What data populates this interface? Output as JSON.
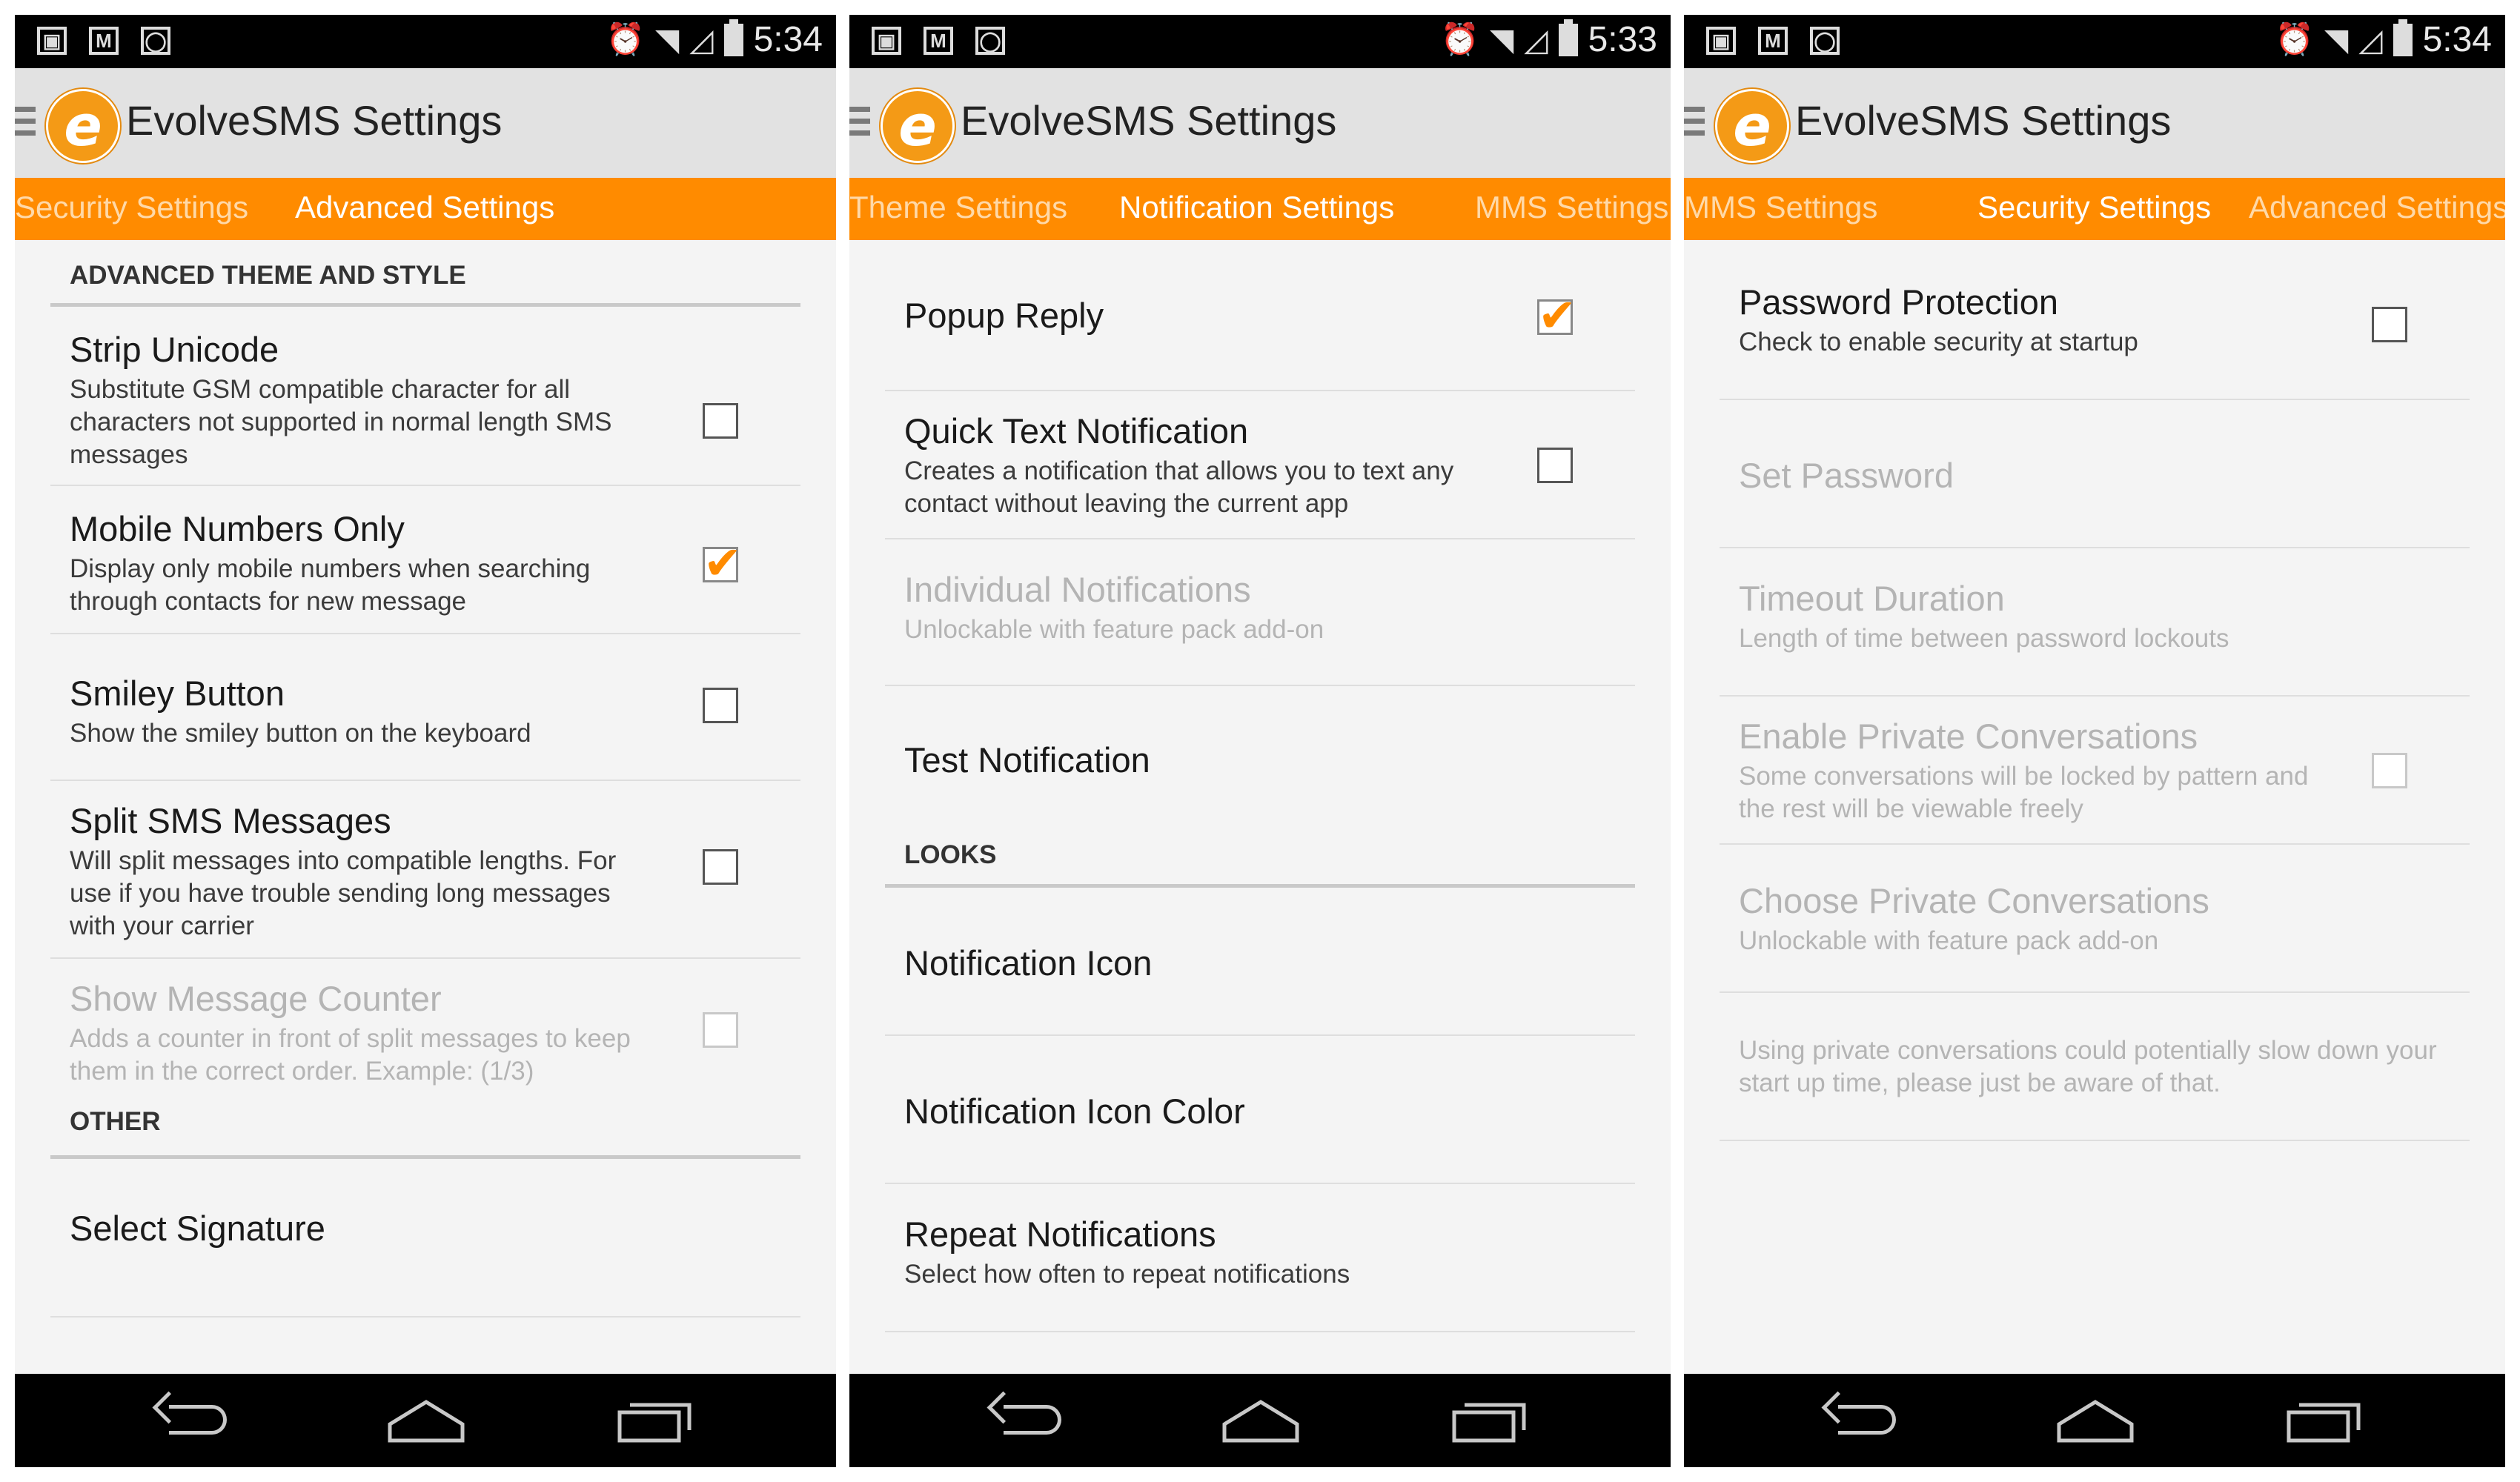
{
  "screens": [
    {
      "status": {
        "time": "5:34"
      },
      "app_title": "EvolveSMS Settings",
      "tabs": [
        "Security Settings",
        "Advanced Settings"
      ],
      "categories": [
        "ADVANCED THEME AND STYLE",
        "OTHER"
      ],
      "prefs": [
        {
          "title": "Strip Unicode",
          "summary": "Substitute GSM compatible character for all characters not supported in normal length SMS messages",
          "checkbox": true,
          "checked": false,
          "enabled": true
        },
        {
          "title": "Mobile Numbers Only",
          "summary": "Display only mobile numbers when searching through contacts for new message",
          "checkbox": true,
          "checked": true,
          "enabled": true
        },
        {
          "title": "Smiley Button",
          "summary": "Show the smiley button on the keyboard",
          "checkbox": true,
          "checked": false,
          "enabled": true
        },
        {
          "title": "Split SMS Messages",
          "summary": "Will split messages into compatible lengths. For use if you have trouble sending long messages with your carrier",
          "checkbox": true,
          "checked": false,
          "enabled": true
        },
        {
          "title": "Show Message Counter",
          "summary": "Adds a counter in front of split messages to keep them in the correct order. Example: (1/3)",
          "checkbox": true,
          "checked": false,
          "enabled": false
        },
        {
          "title": "Select Signature",
          "summary": "",
          "checkbox": false,
          "enabled": true
        }
      ]
    },
    {
      "status": {
        "time": "5:33"
      },
      "app_title": "EvolveSMS Settings",
      "tabs": [
        "Theme Settings",
        "Notification Settings",
        "MMS Settings"
      ],
      "categories": [
        "LOOKS"
      ],
      "prefs": [
        {
          "title": "Popup Reply",
          "summary": "",
          "checkbox": true,
          "checked": true,
          "enabled": true
        },
        {
          "title": "Quick Text Notification",
          "summary": "Creates a notification that allows you to text any contact without leaving the current app",
          "checkbox": true,
          "checked": false,
          "enabled": true
        },
        {
          "title": "Individual Notifications",
          "summary": "Unlockable with feature pack add-on",
          "checkbox": false,
          "enabled": false
        },
        {
          "title": "Test Notification",
          "summary": "",
          "checkbox": false,
          "enabled": true
        },
        {
          "title": "Notification Icon",
          "summary": "",
          "checkbox": false,
          "enabled": true
        },
        {
          "title": "Notification Icon Color",
          "summary": "",
          "checkbox": false,
          "enabled": true
        },
        {
          "title": "Repeat Notifications",
          "summary": "Select how often to repeat notifications",
          "checkbox": false,
          "enabled": true
        }
      ]
    },
    {
      "status": {
        "time": "5:34"
      },
      "app_title": "EvolveSMS Settings",
      "tabs": [
        "MMS Settings",
        "Security Settings",
        "Advanced Settings"
      ],
      "prefs": [
        {
          "title": "Password Protection",
          "summary": "Check to enable security at startup",
          "checkbox": true,
          "checked": false,
          "enabled": true
        },
        {
          "title": "Set Password",
          "summary": "",
          "checkbox": false,
          "enabled": false
        },
        {
          "title": "Timeout Duration",
          "summary": "Length of time between password lockouts",
          "checkbox": false,
          "enabled": false
        },
        {
          "title": "Enable Private Conversations",
          "summary": "Some conversations will be locked by pattern and the rest will be viewable freely",
          "checkbox": true,
          "checked": false,
          "enabled": false
        },
        {
          "title": "Choose Private Conversations",
          "summary": "Unlockable with feature pack add-on",
          "checkbox": false,
          "enabled": false
        },
        {
          "title": "",
          "summary": "Using private conversations could potentially slow down your start up time, please just be aware of that.",
          "checkbox": false,
          "enabled": false
        }
      ]
    }
  ]
}
